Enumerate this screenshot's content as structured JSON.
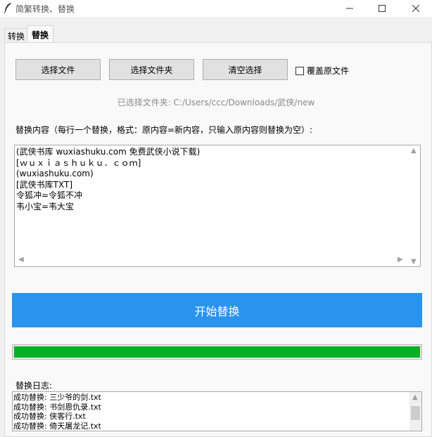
{
  "window": {
    "title": "简繁转换、替换",
    "icons": {
      "app": "feather-icon",
      "minimize": "minimize-icon",
      "maximize": "maximize-icon",
      "close": "close-icon"
    }
  },
  "tabs": [
    {
      "label": "转换",
      "active": false
    },
    {
      "label": "替换",
      "active": true
    }
  ],
  "buttons": {
    "select_file": "选择文件",
    "select_folder": "选择文件夹",
    "clear_selection": "清空选择"
  },
  "overwrite": {
    "label": "覆盖原文件",
    "checked": false
  },
  "selected_folder": "已选择文件夹: C:/Users/ccc/Downloads/武侠/new",
  "replace_section": {
    "label": "替换内容（每行一个替换，格式：原内容=新内容，只输入原内容则替换为空）:",
    "lines": [
      "(武侠书库 wuxiashuku.com 免费武侠小说下载)",
      "[ｗｕｘｉａｓｈｕｋｕ．ｃｏｍ]",
      "(wuxiashuku.com)",
      "[武侠书库TXT]",
      "令狐冲=令狐不冲",
      "韦小宝=韦大宝"
    ]
  },
  "start_button": "开始替换",
  "progress": {
    "fraction": 1.0,
    "color": "#06b025"
  },
  "log": {
    "label": "替换日志:",
    "lines": [
      "成功替换: 三少爷的剑.txt",
      "成功替换: 书剑恩仇录.txt",
      "成功替换: 侠客行.txt",
      "成功替换: 倚天屠龙记.txt"
    ]
  },
  "colors": {
    "accent": "#2a93ee",
    "progress": "#06b025",
    "info_text": "#8a8a8a"
  }
}
